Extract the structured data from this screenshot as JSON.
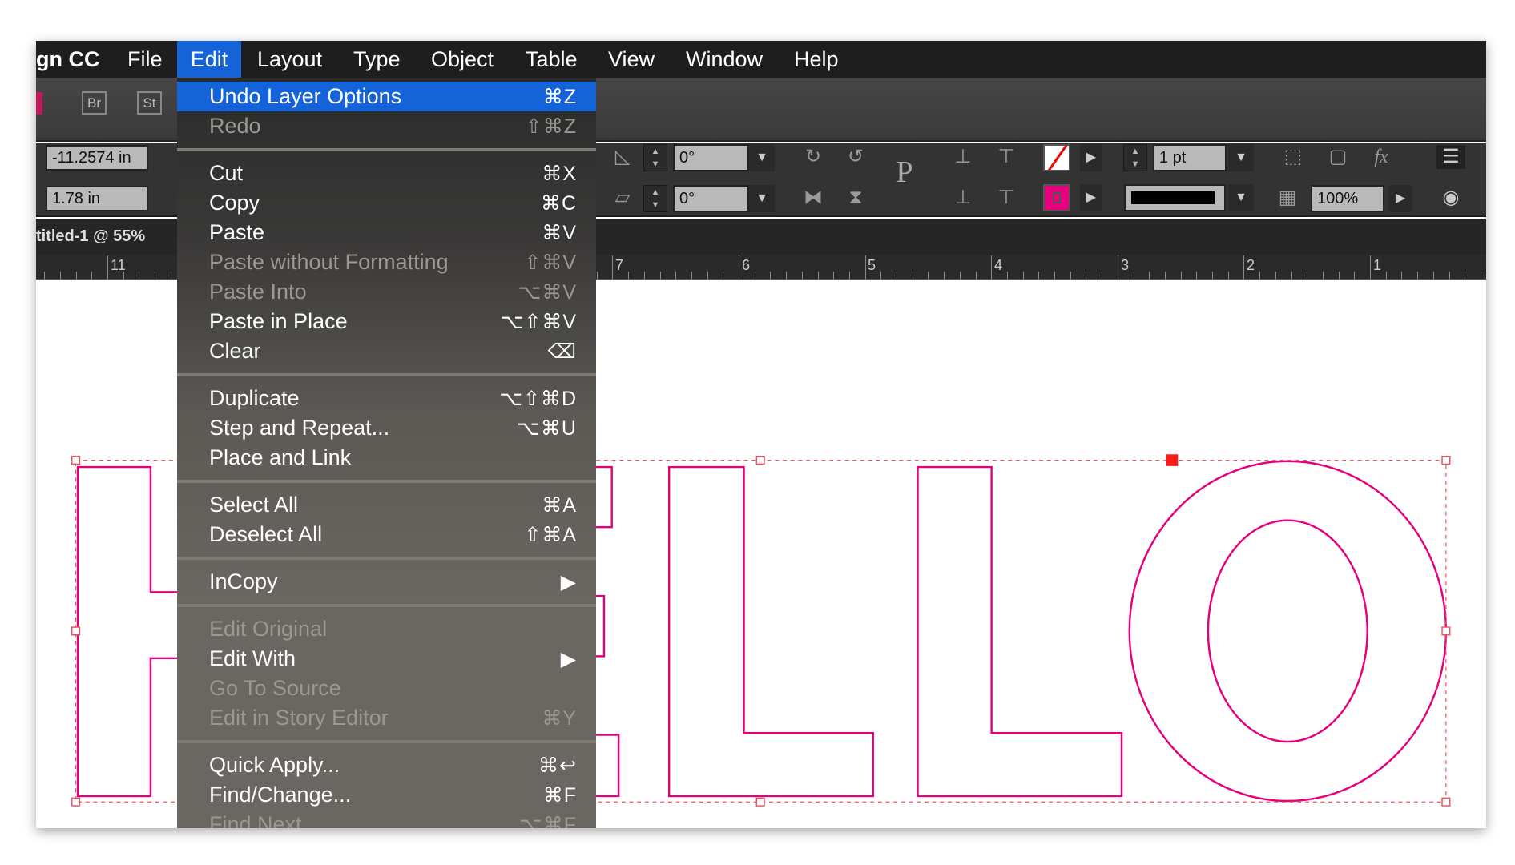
{
  "menubar": {
    "app_name": "gn CC",
    "items": [
      "File",
      "Edit",
      "Layout",
      "Type",
      "Object",
      "Table",
      "View",
      "Window",
      "Help"
    ],
    "active": "Edit"
  },
  "appbar": {
    "bridge_label": "Br",
    "stock_label": "St"
  },
  "control_panel": {
    "x_value": "-11.2574 in",
    "y_value": "1.78 in",
    "rotation_angle": "0°",
    "shear_angle": "0°",
    "stroke_weight": "1 pt",
    "opacity": "100%",
    "fill_color": "none",
    "stroke_color": "#e6007e"
  },
  "document_tab": {
    "title": "titled-1 @ 55%"
  },
  "ruler": {
    "labels": [
      "11",
      "7",
      "6",
      "5",
      "4",
      "3",
      "2",
      "1"
    ]
  },
  "edit_menu": {
    "items": [
      {
        "label": "Undo Layer Options",
        "shortcut": "⌘Z",
        "highlight": true
      },
      {
        "label": "Redo",
        "shortcut": "⇧⌘Z",
        "disabled": true
      },
      {
        "separator": true
      },
      {
        "label": "Cut",
        "shortcut": "⌘X"
      },
      {
        "label": "Copy",
        "shortcut": "⌘C"
      },
      {
        "label": "Paste",
        "shortcut": "⌘V"
      },
      {
        "label": "Paste without Formatting",
        "shortcut": "⇧⌘V",
        "disabled": true
      },
      {
        "label": "Paste Into",
        "shortcut": "⌥⌘V",
        "disabled": true
      },
      {
        "label": "Paste in Place",
        "shortcut": "⌥⇧⌘V"
      },
      {
        "label": "Clear",
        "shortcut": "⌫"
      },
      {
        "separator": true
      },
      {
        "label": "Duplicate",
        "shortcut": "⌥⇧⌘D"
      },
      {
        "label": "Step and Repeat...",
        "shortcut": "⌥⌘U"
      },
      {
        "label": "Place and Link",
        "shortcut": ""
      },
      {
        "separator": true
      },
      {
        "label": "Select All",
        "shortcut": "⌘A"
      },
      {
        "label": "Deselect All",
        "shortcut": "⇧⌘A"
      },
      {
        "separator": true
      },
      {
        "label": "InCopy",
        "shortcut": "▶",
        "submenu": true
      },
      {
        "separator": true
      },
      {
        "label": "Edit Original",
        "shortcut": "",
        "disabled": true
      },
      {
        "label": "Edit With",
        "shortcut": "▶",
        "submenu": true
      },
      {
        "label": "Go To Source",
        "shortcut": "",
        "disabled": true
      },
      {
        "label": "Edit in Story Editor",
        "shortcut": "⌘Y",
        "disabled": true
      },
      {
        "separator": true
      },
      {
        "label": "Quick Apply...",
        "shortcut": "⌘↩"
      },
      {
        "label": "Find/Change...",
        "shortcut": "⌘F"
      },
      {
        "label": "Find Next",
        "shortcut": "⌥⌘F",
        "disabled": true
      }
    ]
  },
  "colors": {
    "accent": "#1463d9",
    "selection": "#e6007e",
    "frame": "#ff0000"
  }
}
